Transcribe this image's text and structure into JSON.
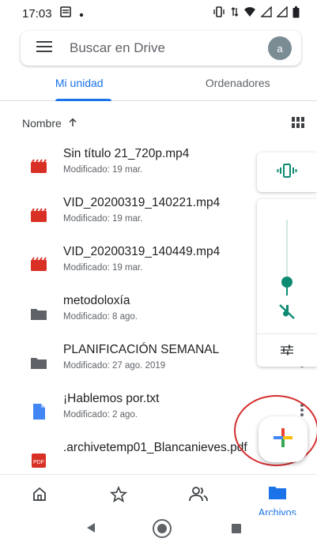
{
  "status_bar": {
    "time": "17:03"
  },
  "search": {
    "placeholder": "Buscar en Drive",
    "avatar_letter": "a"
  },
  "tabs": [
    {
      "label": "Mi unidad",
      "active": true
    },
    {
      "label": "Ordenadores",
      "active": false
    }
  ],
  "sort": {
    "label": "Nombre",
    "direction": "ascending"
  },
  "files": [
    {
      "name": "Sin título 21_720p.mp4",
      "meta": "Modificado: 19 mar.",
      "type": "video"
    },
    {
      "name": "VID_20200319_140221.mp4",
      "meta": "Modificado: 19 mar.",
      "type": "video"
    },
    {
      "name": "VID_20200319_140449.mp4",
      "meta": "Modificado: 19 mar.",
      "type": "video"
    },
    {
      "name": "metodoloxía",
      "meta": "Modificado: 8 ago.",
      "type": "folder"
    },
    {
      "name": "PLANIFICACIÓN SEMANAL",
      "meta": "Modificado: 27 ago. 2019",
      "type": "folder"
    },
    {
      "name": "¡Hablemos por.txt",
      "meta": "Modificado: 2 ago.",
      "type": "doc"
    },
    {
      "name": ".archivetemp01_Blancanieves.pdf",
      "meta": "",
      "type": "pdf"
    }
  ],
  "volume": {
    "level": 0.18
  },
  "bottom_nav": [
    {
      "icon": "home-icon",
      "label": ""
    },
    {
      "icon": "star-icon",
      "label": ""
    },
    {
      "icon": "shared-icon",
      "label": ""
    },
    {
      "icon": "folder-icon",
      "label": "Archivos",
      "active": true
    }
  ],
  "colors": {
    "accent": "#1a73e8",
    "volume": "#0d8a72",
    "video": "#d93025",
    "folder": "#5f6368",
    "doc": "#4285f4",
    "annotation": "#d32f2f"
  }
}
